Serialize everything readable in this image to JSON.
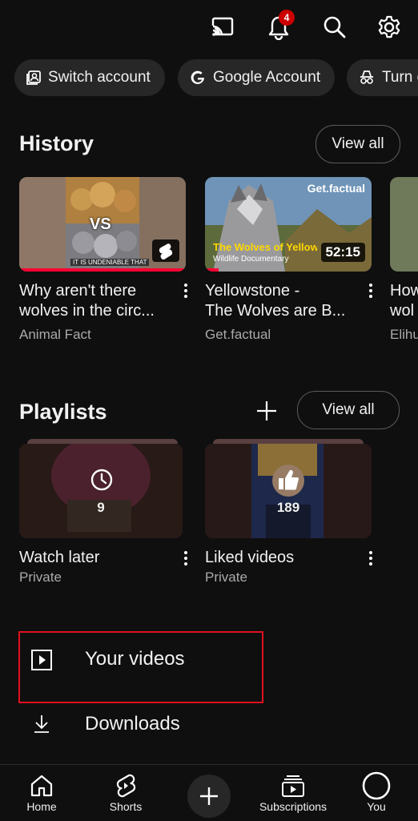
{
  "topbar": {
    "icons": [
      "cast-icon",
      "bell-icon",
      "search-icon",
      "gear-icon"
    ],
    "notification_count": "4"
  },
  "chips": [
    {
      "label": "Switch account",
      "icon": "switch-account-icon"
    },
    {
      "label": "Google Account",
      "icon": "google-g-icon"
    },
    {
      "label": "Turn on Incognito",
      "icon": "incognito-icon"
    }
  ],
  "history": {
    "title": "History",
    "view_all": "View all",
    "videos": [
      {
        "title_line1": "Why aren't there",
        "title_line2": "wolves in the circ...",
        "channel": "Animal Fact",
        "thumb_vs": "VS",
        "thumb_caption": "IT IS UNDENIABLE THAT",
        "is_short": true,
        "progress": 1.0
      },
      {
        "title_line1": "Yellowstone -",
        "title_line2": "The Wolves are B...",
        "channel": "Get.factual",
        "duration": "52:15",
        "thumb_brand": "Get.factual",
        "thumb_title": "The Wolves of Yellowstone",
        "thumb_subtitle": "Wildlife Documentary",
        "progress": 0.08
      },
      {
        "title_line1": "How",
        "title_line2": "wol",
        "channel": "Elihu"
      }
    ]
  },
  "playlists": {
    "title": "Playlists",
    "view_all": "View all",
    "items": [
      {
        "title": "Watch later",
        "privacy": "Private",
        "count": "9",
        "icon": "clock-icon"
      },
      {
        "title": "Liked videos",
        "privacy": "Private",
        "count": "189",
        "icon": "thumbs-up-icon"
      }
    ]
  },
  "menu": {
    "your_videos": "Your videos",
    "downloads": "Downloads"
  },
  "nav": {
    "home": "Home",
    "shorts": "Shorts",
    "subscriptions": "Subscriptions",
    "you": "You"
  },
  "colors": {
    "background": "#0f0f0f",
    "chip": "#272727",
    "accent_red": "#ff0033",
    "badge_red": "#cc0000",
    "highlight_box": "#e01020"
  }
}
